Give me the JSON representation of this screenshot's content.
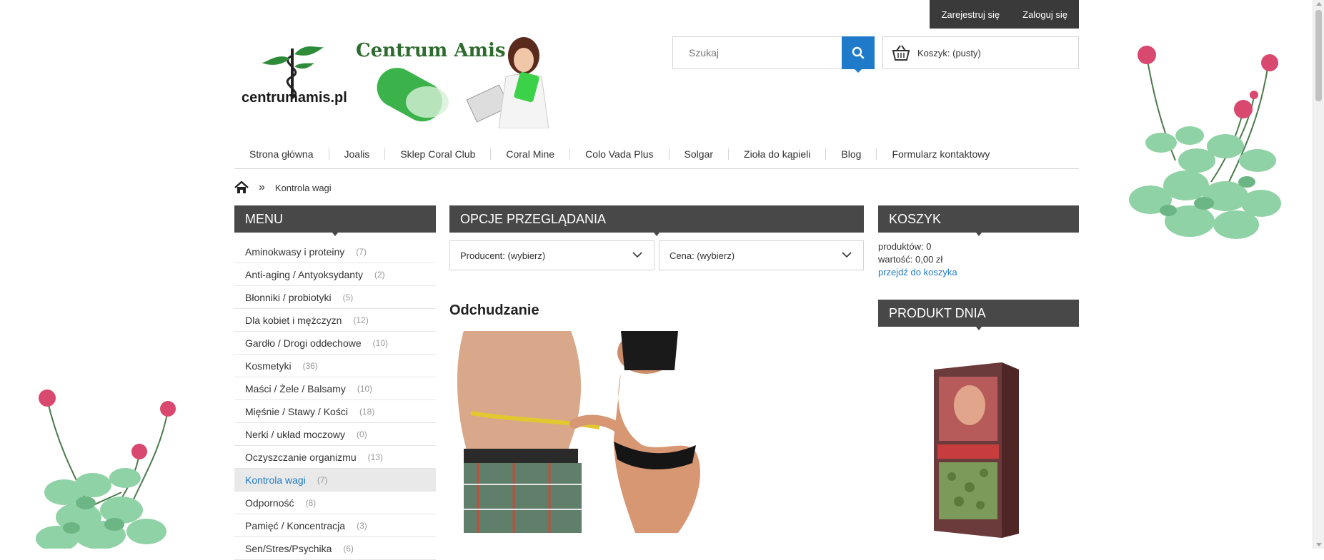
{
  "account": {
    "register": "Zarejestruj się",
    "login": "Zaloguj się"
  },
  "logo": {
    "brand": "Centrum Amis",
    "domain": "centrumamis.pl"
  },
  "search": {
    "placeholder": "Szukaj",
    "icon": "search-icon"
  },
  "cart": {
    "label": "Koszyk: (pusty)",
    "icon": "basket-icon"
  },
  "nav": [
    "Strona główna",
    "Joalis",
    "Sklep Coral Club",
    "Coral Mine",
    "Colo Vada Plus",
    "Solgar",
    "Zioła do kąpieli",
    "Blog",
    "Formularz kontaktowy"
  ],
  "breadcrumb": {
    "home_icon": "home-icon",
    "separator": "»",
    "current": "Kontrola wagi"
  },
  "menu": {
    "title": "MENU",
    "items": [
      {
        "label": "Aminokwasy i proteiny",
        "count": "(7)"
      },
      {
        "label": "Anti-aging / Antyoksydanty",
        "count": "(2)"
      },
      {
        "label": "Błonniki / probiotyki",
        "count": "(5)"
      },
      {
        "label": "Dla kobiet i mężczyzn",
        "count": "(12)"
      },
      {
        "label": "Gardło / Drogi oddechowe",
        "count": "(10)"
      },
      {
        "label": "Kosmetyki",
        "count": "(36)"
      },
      {
        "label": "Maści / Żele / Balsamy",
        "count": "(10)"
      },
      {
        "label": "Mięśnie / Stawy / Kości",
        "count": "(18)"
      },
      {
        "label": "Nerki / układ moczowy",
        "count": "(0)"
      },
      {
        "label": "Oczyszczanie organizmu",
        "count": "(13)"
      },
      {
        "label": "Kontrola wagi",
        "count": "(7)",
        "active": true
      },
      {
        "label": "Odporność",
        "count": "(8)"
      },
      {
        "label": "Pamięć / Koncentracja",
        "count": "(3)"
      },
      {
        "label": "Sen/Stres/Psychika",
        "count": "(6)"
      }
    ]
  },
  "browse": {
    "title": "OPCJE PRZEGLĄDANIA",
    "producer": "Producent: (wybierz)",
    "price": "Cena: (wybierz)"
  },
  "category": {
    "title": "Odchudzanie",
    "next_heading": "Kontrola wagi"
  },
  "cart_block": {
    "title": "KOSZYK",
    "products": "produktów: 0",
    "value": "wartość: 0,00 zł",
    "link": "przejdź do koszyka"
  },
  "product_of_day": {
    "title": "PRODUKT DNIA"
  },
  "colors": {
    "accent": "#1f7bc9",
    "heading_bg": "#484848",
    "topbar_bg": "#3a3a3a"
  }
}
